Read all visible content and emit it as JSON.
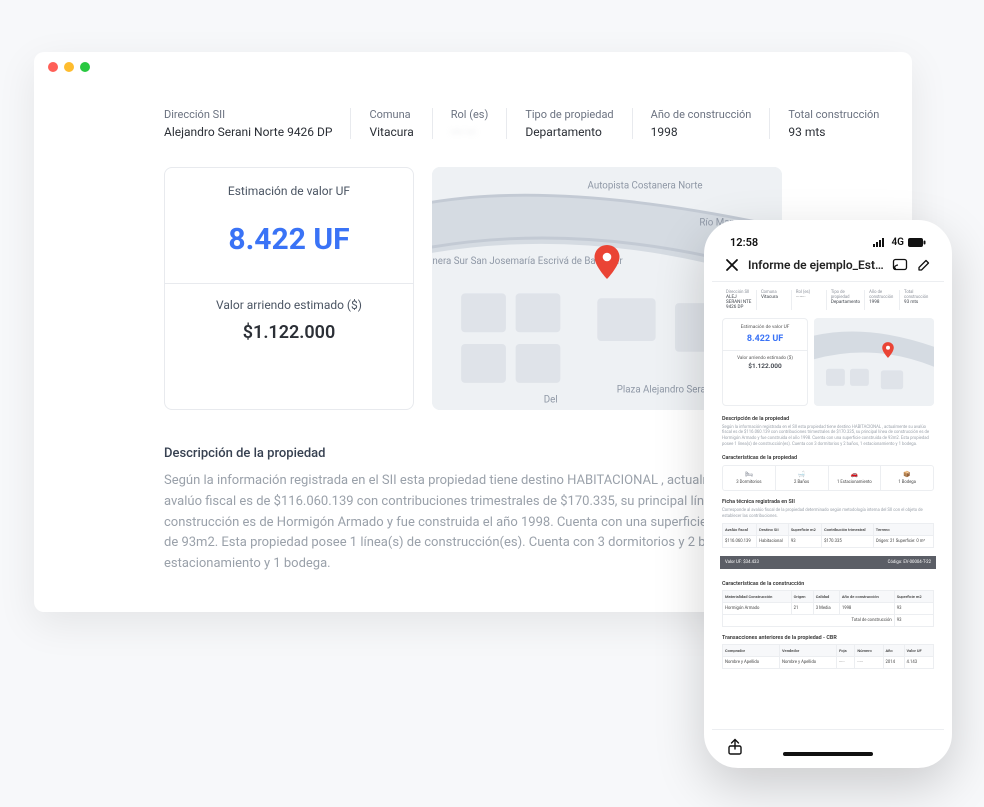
{
  "info": {
    "direccion_label": "Dirección SII",
    "direccion_value": "Alejandro Serani Norte 9426 DP",
    "comuna_label": "Comuna",
    "comuna_value": "Vitacura",
    "rol_label": "Rol (es)",
    "rol_value": "···· ···",
    "tipo_label": "Tipo de propiedad",
    "tipo_value": "Departamento",
    "anio_label": "Año de construcción",
    "anio_value": "1998",
    "total_label": "Total construcción",
    "total_value": "93 mts"
  },
  "valuation": {
    "uf_label": "Estimación de valor UF",
    "uf_value": "8.422 UF",
    "rent_label": "Valor arriendo estimado ($)",
    "rent_value": "$1.122.000"
  },
  "map": {
    "road1": "Autopista Costanera Norte",
    "road2": "anera Sur San Josemaría Escrivá de Balaguer",
    "river": "Río Map",
    "plaza": "Plaza Alejandro Serani",
    "del": "Del"
  },
  "description": {
    "heading": "Descripción de la propiedad",
    "body": "Según la información registrada en el SII esta propiedad tiene destino HABITACIONAL , actualmente su avalúo fiscal es de $116.060.139 con contribuciones trimestrales de $170.335, su principal línea de construcción es de Hormigón Armado y fue construida el año 1998. Cuenta con una superficie construida de 93m2. Esta propiedad posee 1 línea(s) de construcción(es). Cuenta con 3 dormitorios y 2 baños, 1 estacionamiento y 1 bodega."
  },
  "phone": {
    "time": "12:58",
    "net": "4G",
    "doc_title": "Informe de ejemplo_Estimac…",
    "mini_desc_heading": "Descripción de la propiedad",
    "mini_desc_text": "Según la información registrada en el SII esta propiedad tiene destino HABITACIONAL , actualmente su avalúo fiscal es de $116.060.139 con contribuciones trimestrales de $170.335, su principal línea de construcción es de Hormigón Armado y fue construida el año 1998. Cuenta con una superficie construida de 93m2. Esta propiedad posee 1 línea(s) de construcción(es). Cuenta con 3 dormitorios y 2 baños, 1 estacionamiento y 1 bodega.",
    "mini_info": {
      "dir_l": "Dirección SII",
      "dir_v": "ALEJ SERANI NTE 9426 DP",
      "com_l": "Comuna",
      "com_v": "Vitacura",
      "rol_l": "Rol (es)",
      "rol_v": "····-···",
      "tipo_l": "Tipo de propiedad",
      "tipo_v": "Departamento",
      "anio_l": "Año de construcción",
      "anio_v": "1998",
      "tot_l": "Total construcción",
      "tot_v": "93 mts"
    },
    "chars_heading": "Características de la propiedad",
    "chars": {
      "a": "3 Dormitorios",
      "b": "2 Baños",
      "c": "1 Estacionamiento",
      "d": "1 Bodega"
    },
    "fichas_heading": "Ficha técnica registrada en SII",
    "fichas_sub": "Corresponde al avalúo fiscal de la propiedad determinado según metodología interna del SII con el objeto de establecer las contribuciones.",
    "fichas_table": {
      "h1": "Avalúo fiscal",
      "h2": "Destino SII",
      "h3": "Superficie m2",
      "h4": "Contribución trimestral",
      "h5": "Terreno",
      "r1c1": "$116.060.139",
      "r1c2": "Habitacional",
      "r1c3": "93",
      "r1c4": "$170.335",
      "r1c5": "Origen: 21 Superficie: 0 m²"
    },
    "bar_left": "Valor UF: $34.433",
    "bar_right": "Código: EV-00004-T-22",
    "constr_heading": "Características de la construcción",
    "constr_table": {
      "h1": "Materialidad Construcción",
      "h2": "Origen",
      "h3": "Calidad",
      "h4": "Año de construcción",
      "h5": "Superficie m2",
      "r1c1": "Hormigón Armado",
      "r1c2": "21",
      "r1c3": "3 Media",
      "r1c4": "1998",
      "r1c5": "93",
      "tot_l": "Total de construcción",
      "tot_v": "93"
    },
    "trans_heading": "Transacciones anteriores de la propiedad - CBR",
    "trans_table": {
      "h1": "Comprador",
      "h2": "Vendedor",
      "h3": "Foja",
      "h4": "Número",
      "h5": "Año",
      "h6": "Valor UF",
      "r1c1": "Nombre y Apellido",
      "r1c2": "Nombre y Apellido",
      "r1c3": "·····",
      "r1c4": "·····",
      "r1c5": "2014",
      "r1c6": "4.143"
    }
  }
}
